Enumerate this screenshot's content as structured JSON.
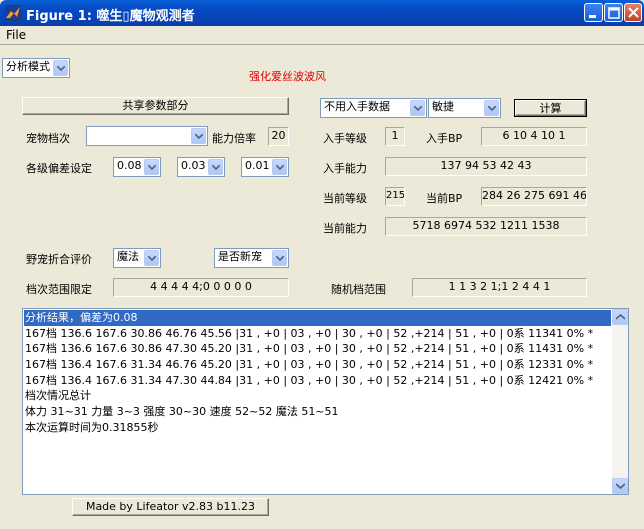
{
  "window": {
    "title": "Figure 1: 噬生\u0000魔物观测者",
    "title_display": "Figure 1: 噬生▯魔物观测者"
  },
  "menu": {
    "file": "File"
  },
  "mode_select": {
    "value": "分析模式"
  },
  "pet_name": "强化爱丝波波风",
  "shared_button": "共享参数部分",
  "input_data_select": {
    "value": "不用入手数据"
  },
  "trait_select": {
    "value": "敏捷"
  },
  "calculate_button": "计算",
  "pet_grade": {
    "label": "宠物档次",
    "value": ""
  },
  "ability_rate": {
    "label": "能力倍率",
    "value": "20"
  },
  "deviation": {
    "label": "各级偏差设定",
    "values": [
      "0.08",
      "0.03",
      "0.01"
    ]
  },
  "acquire_level": {
    "label": "入手等级",
    "value": "1"
  },
  "acquire_bp": {
    "label": "入手BP",
    "value": "6 10 4 10 1"
  },
  "acquire_ability": {
    "label": "入手能力",
    "value": "137 94  53 42 43"
  },
  "current_level": {
    "label": "当前等级",
    "value": "215"
  },
  "current_bp": {
    "label": "当前BP",
    "value": "284 26 275 691 468"
  },
  "current_ability": {
    "label": "当前能力",
    "value": "5718 6974 532 1211 1538"
  },
  "wild_eval": {
    "label": "野宠折合评价",
    "value": "魔法"
  },
  "new_pet_select": {
    "value": "是否新宠"
  },
  "grade_range_limit": {
    "label": "档次范围限定",
    "value": "4 4 4 4 4;0 0 0 0 0"
  },
  "random_range": {
    "label": "随机档范围",
    "value": "1 1 3 2 1;1 2 4 4 1"
  },
  "results": [
    "分析结果，偏差为0.08",
    "167档 136.6 167.6 30.86 46.76 45.56 |31 , +0 | 03 , +0 | 30 , +0 | 52 ,+214 | 51 , +0 | 0系 11341   0% *",
    "167档 136.6 167.6 30.86 47.30 45.20 |31 , +0 | 03 , +0 | 30 , +0 | 52 ,+214 | 51 , +0 | 0系 11431   0% *",
    "167档 136.4 167.6 31.34 46.76 45.20 |31 , +0 | 03 , +0 | 30 , +0 | 52 ,+214 | 51 , +0 | 0系 12331   0% *",
    "167档 136.4 167.6 31.34 47.30 44.84 |31 , +0 | 03 , +0 | 30 , +0 | 52 ,+214 | 51 , +0 | 0系 12421   0% *",
    "档次情况总计",
    "体力 31~31 力量 3~3 强度 30~30 速度 52~52 魔法 51~51",
    "本次运算时间为0.31855秒"
  ],
  "footer_button": "Made by Lifeator   v2.83 b11.23",
  "colors": {
    "titlebar": "#0548c4",
    "selection": "#316ac5",
    "pet_name": "#e00000"
  }
}
